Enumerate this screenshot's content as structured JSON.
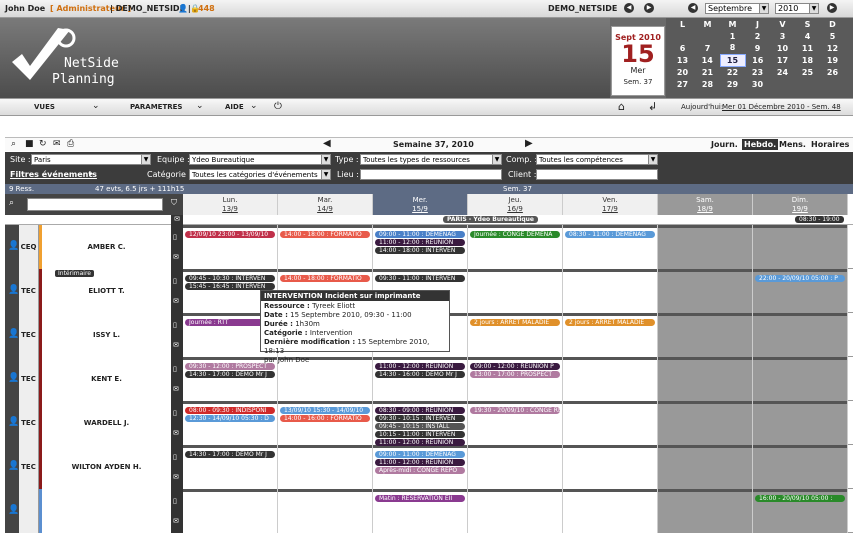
{
  "topbar": {
    "user": "John Doe",
    "role": "[ Administrateur ]",
    "site": "| DEMO_NETSIDE |",
    "count": "448",
    "center": "DEMO_NETSIDE"
  },
  "calendar": {
    "month": "Septembre",
    "year": "2010",
    "days_header": [
      "L",
      "M",
      "M",
      "J",
      "V",
      "S",
      "D"
    ],
    "weeks": [
      [
        "",
        "",
        "1",
        "2",
        "3",
        "4",
        "5"
      ],
      [
        "6",
        "7",
        "8",
        "9",
        "10",
        "11",
        "12"
      ],
      [
        "13",
        "14",
        "15",
        "16",
        "17",
        "18",
        "19"
      ],
      [
        "20",
        "21",
        "22",
        "23",
        "24",
        "25",
        "26"
      ],
      [
        "27",
        "28",
        "29",
        "30",
        "",
        "",
        ""
      ]
    ]
  },
  "datebox": {
    "month": "Sept 2010",
    "day": "15",
    "weekday": "Mer",
    "week": "Sem. 37"
  },
  "logo": {
    "line1": "NetSide",
    "line2": "Planning"
  },
  "menu": {
    "vues": "VUES",
    "parametres": "PARAMETRES",
    "aide": "AIDE"
  },
  "today": {
    "label": "Aujourd'hui:",
    "value": "Mer 01 Décembre 2010 - Sem. 48"
  },
  "toolbar": {
    "week": "Semaine 37, 2010",
    "journ": "Journ.",
    "hebdo": "Hebdo.",
    "mens": "Mens.",
    "horaires": "Horaires"
  },
  "filters": {
    "site_label": "Site :",
    "site": "Paris",
    "equipe_label": "Equipe :",
    "equipe": "Ydeo Bureautique",
    "type_label": "Type :",
    "type": "Toutes les types de ressources",
    "comp_label": "Comp. :",
    "comp": "Toutes les compétences",
    "filtres": "Filtres événements",
    "cat_label": "Catégorie :",
    "cat": "Toutes les catégories d'événements",
    "lieu_label": "Lieu :",
    "client_label": "Client :"
  },
  "grid": {
    "ress": "9 Ress.",
    "stats": "47 evts, 6.5 jrs + 111h15",
    "sem": "Sem. 37",
    "banner": "PARIS - Ydeo Bureautique",
    "hours": "08:30 - 19:00",
    "interimaire": "Intérimaire"
  },
  "days": [
    {
      "n": "Lun.",
      "d": "13/9"
    },
    {
      "n": "Mar.",
      "d": "14/9"
    },
    {
      "n": "Mer.",
      "d": "15/9"
    },
    {
      "n": "Jeu.",
      "d": "16/9"
    },
    {
      "n": "Ven.",
      "d": "17/9"
    },
    {
      "n": "Sam.",
      "d": "18/9"
    },
    {
      "n": "Dim.",
      "d": "19/9"
    }
  ],
  "resources": [
    {
      "type": "CEQ",
      "name": "AMBER C.",
      "color": "#f0a030"
    },
    {
      "type": "TEC",
      "name": "ELIOTT T.",
      "color": "#8b1a1a"
    },
    {
      "type": "TEC",
      "name": "ISSY L.",
      "color": "#8b1a1a"
    },
    {
      "type": "TEC",
      "name": "KENT E.",
      "color": "#8b1a1a"
    },
    {
      "type": "TEC",
      "name": "WARDELL J.",
      "color": "#8b1a1a"
    },
    {
      "type": "TEC",
      "name": "WILTON AYDEN H.",
      "color": "#8b1a1a"
    },
    {
      "type": "",
      "name": "",
      "color": "#5b8fd0"
    }
  ],
  "events": [
    {
      "r": 0,
      "d": 0,
      "l": 0,
      "t": "12/09/10 23:00 - 13/09/10",
      "c": "#c0304a"
    },
    {
      "r": 0,
      "d": 1,
      "l": 0,
      "t": "14:00 - 18:00 : FORMATIO",
      "c": "#e85a4a"
    },
    {
      "r": 0,
      "d": 2,
      "l": 0,
      "t": "09:00 - 11:00 : DEMENAG",
      "c": "#4a80c8"
    },
    {
      "r": 0,
      "d": 2,
      "l": 1,
      "t": "11:00 - 12:00 : REUNION",
      "c": "#3a1a40"
    },
    {
      "r": 0,
      "d": 2,
      "l": 2,
      "t": "14:00 - 18:00 : INTERVEN",
      "c": "#333"
    },
    {
      "r": 0,
      "d": 3,
      "l": 0,
      "t": "Journée : CONGE DEMENA",
      "c": "#2a8a2a"
    },
    {
      "r": 0,
      "d": 4,
      "l": 0,
      "t": "08:30 - 11:00 : DEMENAG",
      "c": "#5a9ad8"
    },
    {
      "r": 1,
      "d": 0,
      "l": 0,
      "t": "09:45 - 10:30 : INTERVEN",
      "c": "#333"
    },
    {
      "r": 1,
      "d": 0,
      "l": 1,
      "t": "15:45 - 16:45 : INTERVEN",
      "c": "#333"
    },
    {
      "r": 1,
      "d": 1,
      "l": 0,
      "t": "14:00 - 18:00 : FORMATIO",
      "c": "#e85a4a"
    },
    {
      "r": 1,
      "d": 2,
      "l": 0,
      "t": "09:30 - 11:00 : INTERVEN",
      "c": "#333"
    },
    {
      "r": 1,
      "d": 6,
      "l": 0,
      "t": "22:00 - 20/09/10 05:00 : P",
      "c": "#5a9ad8"
    },
    {
      "r": 2,
      "d": 0,
      "l": 0,
      "t": "Journée : RTT",
      "c": "#8a3a90"
    },
    {
      "r": 2,
      "d": 3,
      "l": 0,
      "t": "2 jours : ARRET MALADIE",
      "c": "#e0902a"
    },
    {
      "r": 2,
      "d": 4,
      "l": 0,
      "t": "2 jours : ARRET MALADIE",
      "c": "#e0902a"
    },
    {
      "r": 3,
      "d": 0,
      "l": 0,
      "t": "09:30 - 12:00 : PROSPECT",
      "c": "#b07aa0"
    },
    {
      "r": 3,
      "d": 0,
      "l": 1,
      "t": "14:30 - 17:00 : DEMO Mr J",
      "c": "#333"
    },
    {
      "r": 3,
      "d": 2,
      "l": 0,
      "t": "11:00 - 12:00 : REUNION",
      "c": "#3a1a40"
    },
    {
      "r": 3,
      "d": 2,
      "l": 1,
      "t": "14:30 - 16:00 : DEMO Mr J",
      "c": "#333"
    },
    {
      "r": 3,
      "d": 3,
      "l": 0,
      "t": "09:00 - 12:00 : REUNION P",
      "c": "#3a1a40"
    },
    {
      "r": 3,
      "d": 3,
      "l": 1,
      "t": "13:00 - 17:00 : PROSPECT",
      "c": "#b07aa0"
    },
    {
      "r": 4,
      "d": 0,
      "l": 0,
      "t": "08:00 - 09:30 : INDISPONI",
      "c": "#d02a2a"
    },
    {
      "r": 4,
      "d": 0,
      "l": 1,
      "t": "12:30 - 14/09/10 05:30 : D",
      "c": "#5a9ad8"
    },
    {
      "r": 4,
      "d": 1,
      "l": 0,
      "t": "13/09/10 15:30 - 14/09/10",
      "c": "#5a9ad8"
    },
    {
      "r": 4,
      "d": 1,
      "l": 1,
      "t": "14:00 - 16:00 : FORMATIO",
      "c": "#e85a4a"
    },
    {
      "r": 4,
      "d": 2,
      "l": 0,
      "t": "08:30 - 09:00 : REUNION",
      "c": "#3a1a40"
    },
    {
      "r": 4,
      "d": 2,
      "l": 1,
      "t": "09:30 - 10:15 : INTERVEN",
      "c": "#333"
    },
    {
      "r": 4,
      "d": 2,
      "l": 2,
      "t": "09:45 - 10:15 : INSTALL",
      "c": "#555"
    },
    {
      "r": 4,
      "d": 2,
      "l": 3,
      "t": "10:15 - 11:00 : INTERVEN",
      "c": "#333"
    },
    {
      "r": 4,
      "d": 2,
      "l": 4,
      "t": "11:00 - 12:00 : REUNION",
      "c": "#3a1a40"
    },
    {
      "r": 4,
      "d": 3,
      "l": 0,
      "t": "19:30 - 20/09/10 : CONGE RE",
      "c": "#b07aa0"
    },
    {
      "r": 5,
      "d": 0,
      "l": 0,
      "t": "14:30 - 17:00 : DEMO Mr J",
      "c": "#333"
    },
    {
      "r": 5,
      "d": 2,
      "l": 0,
      "t": "09:00 - 11:00 : DEMENAG",
      "c": "#5a9ad8"
    },
    {
      "r": 5,
      "d": 2,
      "l": 1,
      "t": "11:00 - 12:00 : REUNION",
      "c": "#3a1a40"
    },
    {
      "r": 5,
      "d": 2,
      "l": 2,
      "t": "Après-midi : CONGE REPO",
      "c": "#b07aa0"
    },
    {
      "r": 6,
      "d": 2,
      "l": 0,
      "t": "Matin : RESERVATION EII",
      "c": "#8a3a90"
    },
    {
      "r": 6,
      "d": 6,
      "l": 0,
      "t": "16:00 - 20/09/10 05:00 : ",
      "c": "#2a8a2a"
    }
  ],
  "tooltip": {
    "title": "INTERVENTION Incident sur imprimante",
    "l1": "Ressource :",
    "v1": "Tyreek Eliott",
    "l2": "Date :",
    "v2": "15 Septembre 2010, 09:30 - 11:00",
    "l3": "Durée :",
    "v3": "1h30m",
    "l4": "Catégorie :",
    "v4": "Intervention",
    "l5": "Dernière modification :",
    "v5": "15 Septembre 2010, 18:13",
    "v6": "par John Doe"
  }
}
